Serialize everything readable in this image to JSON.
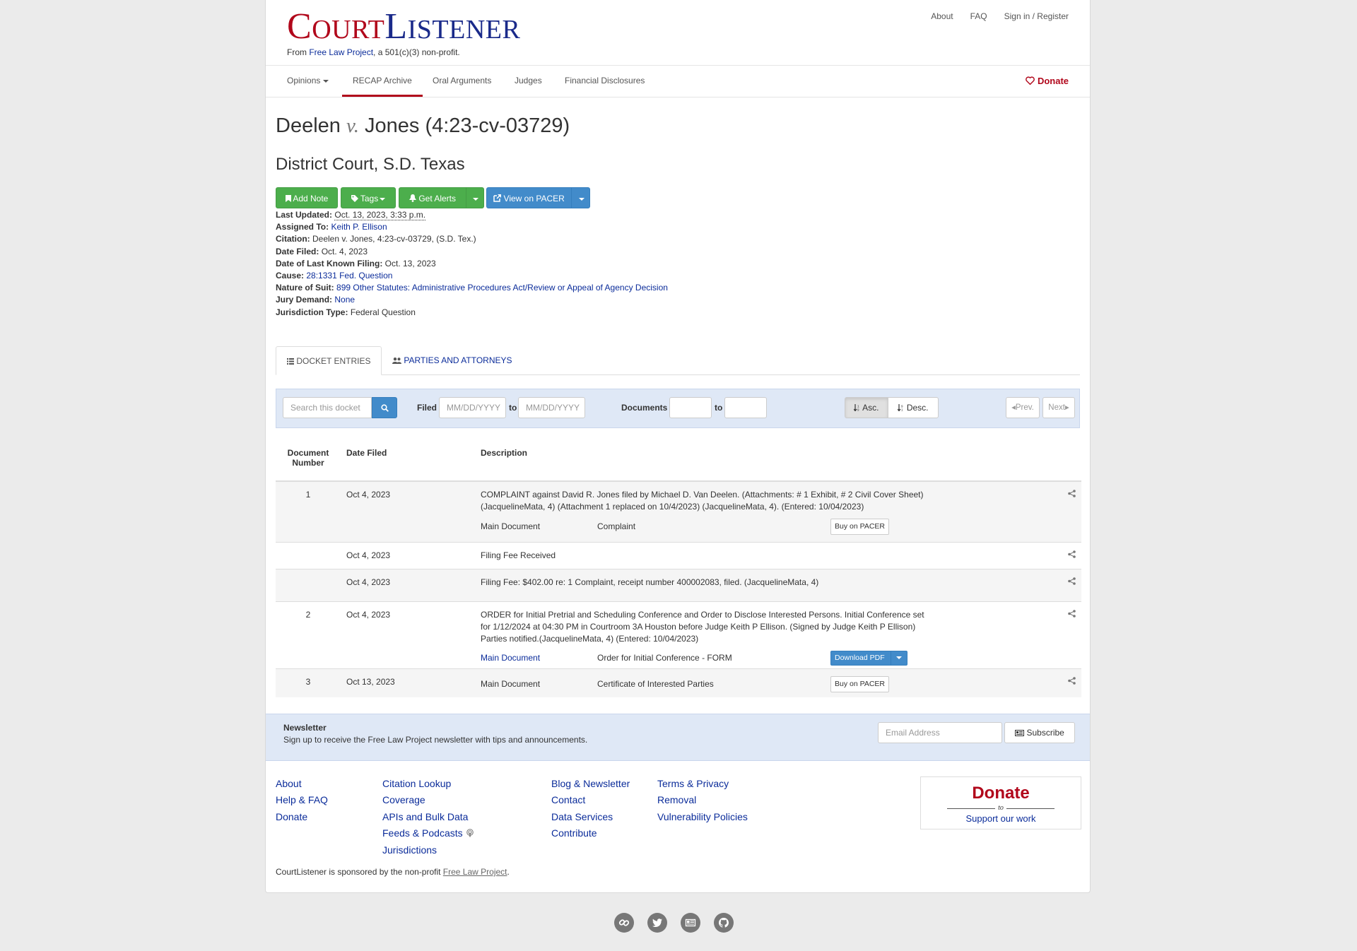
{
  "header": {
    "logo_first_initial": "C",
    "logo_first_rest": "OURT",
    "logo_second_initial": "L",
    "logo_second_rest": "ISTENER",
    "tagline_prefix": "From ",
    "tagline_link": "Free Law Project",
    "tagline_suffix": ", a 501(c)(3) non-profit.",
    "top_links": [
      "About",
      "FAQ",
      "Sign in / Register"
    ]
  },
  "nav": {
    "items": [
      "Opinions",
      "RECAP Archive",
      "Oral Arguments",
      "Judges",
      "Financial Disclosures"
    ],
    "active": "RECAP Archive",
    "donate": "Donate"
  },
  "case": {
    "party1": "Deelen",
    "vs": "v.",
    "party2": "Jones",
    "docket_number": "(4:23-cv-03729)",
    "court": "District Court, S.D. Texas"
  },
  "actions": {
    "add_note": "Add Note",
    "tags": "Tags",
    "get_alerts": "Get Alerts",
    "view_on_pacer": "View on PACER"
  },
  "meta": {
    "last_updated_label": "Last Updated:",
    "last_updated": "Oct. 13, 2023, 3:33 p.m.",
    "assigned_label": "Assigned To:",
    "assigned": "Keith P. Ellison",
    "citation_label": "Citation:",
    "citation": "Deelen v. Jones, 4:23-cv-03729, (S.D. Tex.)",
    "date_filed_label": "Date Filed:",
    "date_filed": "Oct. 4, 2023",
    "last_filing_label": "Date of Last Known Filing:",
    "last_filing": "Oct. 13, 2023",
    "cause_label": "Cause:",
    "cause": "28:1331 Fed. Question",
    "nature_label": "Nature of Suit:",
    "nature": "899 Other Statutes: Administrative Procedures Act/Review or Appeal of Agency Decision",
    "jury_label": "Jury Demand:",
    "jury": "None",
    "jurisdiction_label": "Jurisdiction Type:",
    "jurisdiction": "Federal Question"
  },
  "tabs": {
    "docket_entries": "DOCKET ENTRIES",
    "parties": "PARTIES AND ATTORNEYS"
  },
  "filters": {
    "search_placeholder": "Search this docket",
    "filed_label": "Filed",
    "date_placeholder": "MM/DD/YYYY",
    "to": "to",
    "documents_label": "Documents",
    "asc": "Asc.",
    "desc": "Desc.",
    "prev": "Prev.",
    "next": "Next"
  },
  "table": {
    "headers": [
      "Document Number",
      "Date Filed",
      "Description"
    ],
    "rows": [
      {
        "num": "1",
        "date": "Oct 4, 2023",
        "desc": "COMPLAINT against David R. Jones filed by Michael D. Van Deelen. (Attachments: # 1 Exhibit, # 2 Civil Cover Sheet) (JacquelineMata, 4) (Attachment 1 replaced on 10/4/2023) (JacquelineMata, 4). (Entered: 10/04/2023)",
        "sub_label": "Main Document",
        "sub_desc": "Complaint",
        "sub_action": "Buy on PACER"
      },
      {
        "num": "",
        "date": "Oct 4, 2023",
        "desc": "Filing Fee Received"
      },
      {
        "num": "",
        "date": "Oct 4, 2023",
        "desc": "Filing Fee: $402.00 re: 1 Complaint, receipt number 400002083, filed. (JacquelineMata, 4)"
      },
      {
        "num": "2",
        "date": "Oct 4, 2023",
        "desc": "ORDER for Initial Pretrial and Scheduling Conference and Order to Disclose Interested Persons. Initial Conference set for 1/12/2024 at 04:30 PM in Courtroom 3A Houston before Judge Keith P Ellison. (Signed by Judge Keith P Ellison) Parties notified.(JacquelineMata, 4) (Entered: 10/04/2023)",
        "sub_label": "Main Document",
        "sub_desc": "Order for Initial Conference - FORM",
        "sub_action": "Download PDF"
      },
      {
        "num": "3",
        "date": "Oct 13, 2023",
        "label": "Main Document",
        "doc": "Certificate of Interested Parties",
        "action": "Buy on PACER"
      }
    ]
  },
  "newsletter": {
    "heading": "Newsletter",
    "text": "Sign up to receive the Free Law Project newsletter with tips and announcements.",
    "placeholder": "Email Address",
    "button": "Subscribe"
  },
  "footer": {
    "col1": [
      "About",
      "Help & FAQ",
      "Donate"
    ],
    "col2": [
      "Citation Lookup",
      "Coverage",
      "APIs and Bulk Data",
      "Feeds & Podcasts",
      "Jurisdictions"
    ],
    "col3": [
      "Blog & Newsletter",
      "Contact",
      "Data Services",
      "Contribute"
    ],
    "col4": [
      "Terms & Privacy",
      "Removal",
      "Vulnerability Policies"
    ],
    "donate_big": "Donate",
    "donate_to": "to",
    "donate_support": "Support our work",
    "sponsor_prefix": "CourtListener is sponsored by the non-profit ",
    "sponsor_link": "Free Law Project",
    "sponsor_suffix": "."
  },
  "social_icons": [
    "link-icon",
    "twitter-icon",
    "newsletter-icon",
    "github-icon"
  ],
  "colors": {
    "brand_red": "#b1071b",
    "brand_blue": "#1a2a8a",
    "link": "#0b2c9a",
    "success": "#4cae4c",
    "primary": "#428bca"
  }
}
